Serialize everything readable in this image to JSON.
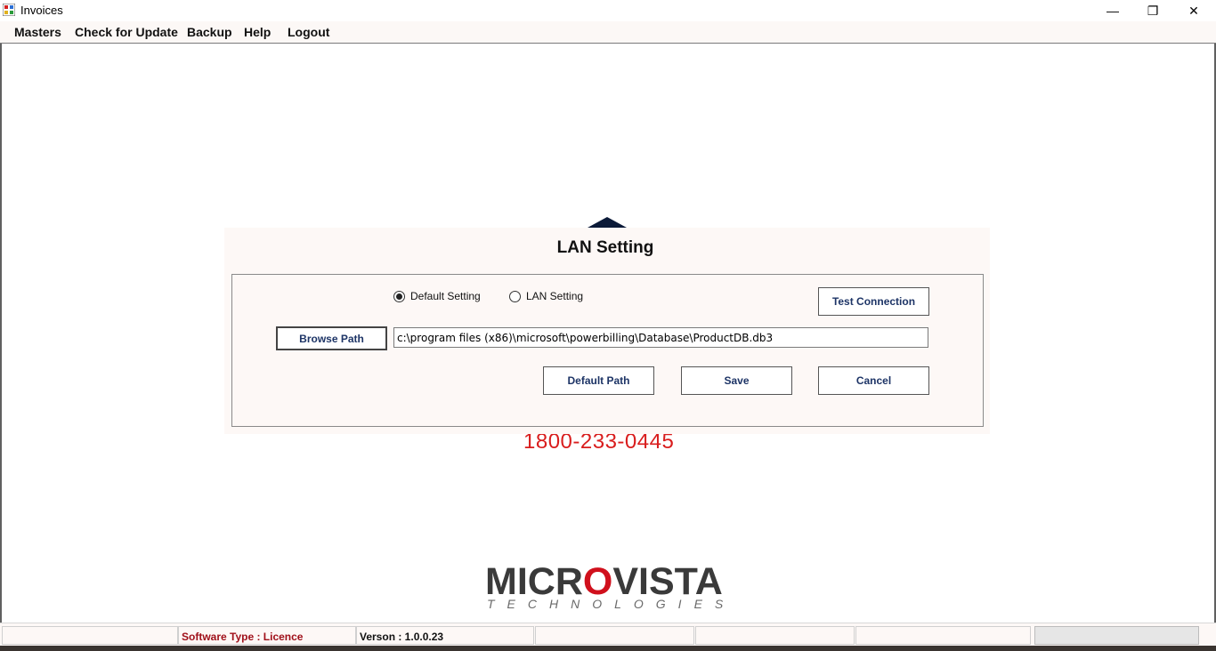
{
  "window": {
    "title": "Invoices",
    "controls": {
      "minimize": "—",
      "restore": "❐",
      "close": "✕"
    }
  },
  "menu": {
    "items": [
      "Masters",
      "Check for Update",
      "Backup",
      "Help",
      "Logout"
    ]
  },
  "dialog": {
    "title": "LAN Setting",
    "radios": [
      {
        "label": "Default Setting",
        "checked": true
      },
      {
        "label": "LAN Setting",
        "checked": false
      }
    ],
    "test_connection_label": "Test Connection",
    "browse_path_label": "Browse Path",
    "path_value": "c:\\program files (x86)\\microsoft\\powerbilling\\Database\\ProductDB.db3",
    "default_path_label": "Default Path",
    "save_label": "Save",
    "cancel_label": "Cancel"
  },
  "background": {
    "phone": "1800-233-0445",
    "logo": {
      "part1": "MICR",
      "part2": "O",
      "part3": "VISTA",
      "sub": "TECHNOLOGIES"
    }
  },
  "statusbar": {
    "software_type": "Software Type : Licence",
    "version": "Verson : 1.0.0.23"
  },
  "colors": {
    "accent_red": "#d91d1d",
    "button_text": "#1d3466",
    "logo_dark": "#3a3a3a"
  }
}
